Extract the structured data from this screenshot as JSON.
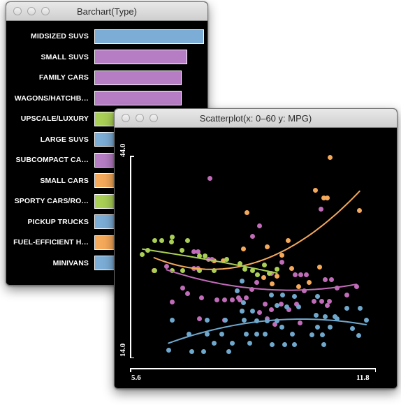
{
  "barchart_window": {
    "title": "Barchart(Type)",
    "traffic_lights": [
      "close",
      "minimize",
      "zoom"
    ],
    "bars": [
      {
        "label": "MIDSIZED SUVS",
        "value": 157,
        "color": "#7cadd6"
      },
      {
        "label": "SMALL SUVS",
        "value": 133,
        "color": "#b67dc4"
      },
      {
        "label": "FAMILY CARS",
        "value": 125,
        "color": "#b67dc4"
      },
      {
        "label": "WAGONS/HATCHB…",
        "value": 125,
        "color": "#b67dc4"
      },
      {
        "label": "UPSCALE/LUXURY",
        "value": 52,
        "color": "#a9cf56"
      },
      {
        "label": "LARGE SUVS",
        "value": 52,
        "color": "#7cadd6"
      },
      {
        "label": "SUBCOMPACT CA…",
        "value": 52,
        "color": "#b67dc4"
      },
      {
        "label": "SMALL CARS",
        "value": 52,
        "color": "#f5a95a"
      },
      {
        "label": "SPORTY CARS/RO…",
        "value": 52,
        "color": "#a9cf56"
      },
      {
        "label": "PICKUP TRUCKS",
        "value": 52,
        "color": "#7cadd6"
      },
      {
        "label": "FUEL-EFFICIENT H…",
        "value": 36,
        "color": "#f5a95a"
      },
      {
        "label": "MINIVANS",
        "value": 36,
        "color": "#7cadd6"
      }
    ]
  },
  "scatter_window": {
    "title": "Scatterplot(x: 0–60 y: MPG)",
    "traffic_lights": [
      "close",
      "minimize",
      "zoom"
    ]
  },
  "chart_data": {
    "type": "scatter",
    "title": "Scatterplot(x: 0–60 y: MPG)",
    "xlabel": "0-60",
    "ylabel": "MPG",
    "xlim": [
      5.6,
      11.8
    ],
    "ylim": [
      14.0,
      44.0
    ],
    "xticks": [
      "5.6",
      "11.8"
    ],
    "yticks": [
      "14.0",
      "44.0"
    ],
    "grid": false,
    "legend": "none",
    "background": "#000000",
    "series": [
      {
        "name": "orange",
        "color": "#f5a95a",
        "points": [
          [
            10.62,
            43.7
          ],
          [
            10.24,
            38.9
          ],
          [
            10.46,
            37.7
          ],
          [
            10.54,
            37.7
          ],
          [
            11.38,
            35.9
          ],
          [
            8.48,
            35.6
          ],
          [
            9.54,
            31.4
          ],
          [
            8.38,
            30.2
          ],
          [
            9.0,
            30.5
          ],
          [
            9.38,
            29.3
          ],
          [
            7.62,
            28.4
          ],
          [
            7.86,
            28.4
          ],
          [
            9.62,
            27.3
          ],
          [
            9.25,
            26.2
          ],
          [
            10.35,
            27.5
          ],
          [
            9.12,
            25.0
          ],
          [
            8.9,
            25.9
          ],
          [
            10.08,
            25.2
          ],
          [
            9.8,
            24.6
          ],
          [
            6.08,
            27.0
          ]
        ],
        "trend": "quadratic-increasing"
      },
      {
        "name": "magenta",
        "color": "#c06cb8",
        "points": [
          [
            7.52,
            40.6
          ],
          [
            10.38,
            36.1
          ],
          [
            8.8,
            33.6
          ],
          [
            8.62,
            32.1
          ],
          [
            7.1,
            29.8
          ],
          [
            7.22,
            29.8
          ],
          [
            7.48,
            28.6
          ],
          [
            7.58,
            28.6
          ],
          [
            6.4,
            27.6
          ],
          [
            7.1,
            27.3
          ],
          [
            7.22,
            27.3
          ],
          [
            9.38,
            28.2
          ],
          [
            9.1,
            26.6
          ],
          [
            9.72,
            26.4
          ],
          [
            9.86,
            26.4
          ],
          [
            10.0,
            26.4
          ],
          [
            8.72,
            25.2
          ],
          [
            6.82,
            24.4
          ],
          [
            8.6,
            24.2
          ],
          [
            9.95,
            24.0
          ],
          [
            10.8,
            24.4
          ],
          [
            11.3,
            24.6
          ],
          [
            10.5,
            25.6
          ],
          [
            10.65,
            25.6
          ],
          [
            8.25,
            23.0
          ],
          [
            8.45,
            23.0
          ],
          [
            7.7,
            22.6
          ],
          [
            7.9,
            22.6
          ],
          [
            8.1,
            22.6
          ],
          [
            8.3,
            22.6
          ],
          [
            8.95,
            22.0
          ],
          [
            9.35,
            22.0
          ],
          [
            9.75,
            22.0
          ],
          [
            10.2,
            22.4
          ],
          [
            10.4,
            22.4
          ],
          [
            10.6,
            22.4
          ],
          [
            9.1,
            21.2
          ],
          [
            9.55,
            21.2
          ],
          [
            8.35,
            21.0
          ],
          [
            8.8,
            20.8
          ],
          [
            7.25,
            19.8
          ],
          [
            7.9,
            19.6
          ],
          [
            9.0,
            19.8
          ],
          [
            9.2,
            19.0
          ],
          [
            9.85,
            19.2
          ],
          [
            10.55,
            21.8
          ],
          [
            6.95,
            23.6
          ],
          [
            7.3,
            23.0
          ],
          [
            6.55,
            22.3
          ],
          [
            11.05,
            23.4
          ]
        ],
        "trend": "increasing-curve"
      },
      {
        "name": "green",
        "color": "#a9cf56",
        "points": [
          [
            6.55,
            32.0
          ],
          [
            6.1,
            31.4
          ],
          [
            6.28,
            31.4
          ],
          [
            6.52,
            31.2
          ],
          [
            6.95,
            31.4
          ],
          [
            5.78,
            29.4
          ],
          [
            6.8,
            30.0
          ],
          [
            7.25,
            29.2
          ],
          [
            7.4,
            29.2
          ],
          [
            7.95,
            28.6
          ],
          [
            8.3,
            28.0
          ],
          [
            6.1,
            27.0
          ],
          [
            6.55,
            27.0
          ],
          [
            6.82,
            27.0
          ],
          [
            7.25,
            27.0
          ],
          [
            7.62,
            27.0
          ],
          [
            8.62,
            27.0
          ],
          [
            8.42,
            27.2
          ],
          [
            8.92,
            27.8
          ],
          [
            9.05,
            26.6
          ],
          [
            9.25,
            27.2
          ],
          [
            8.75,
            26.4
          ],
          [
            5.92,
            30.0
          ]
        ],
        "trend": "hump-then-decline"
      },
      {
        "name": "blue",
        "color": "#6fa8cd",
        "points": [
          [
            8.35,
            25.4
          ],
          [
            8.22,
            24.0
          ],
          [
            9.1,
            23.4
          ],
          [
            9.4,
            23.4
          ],
          [
            9.7,
            23.2
          ],
          [
            10.3,
            23.2
          ],
          [
            8.38,
            22.2
          ],
          [
            9.25,
            21.8
          ],
          [
            9.5,
            21.6
          ],
          [
            9.8,
            21.6
          ],
          [
            11.05,
            21.4
          ],
          [
            11.4,
            21.4
          ],
          [
            8.35,
            21.0
          ],
          [
            8.62,
            21.0
          ],
          [
            10.25,
            20.4
          ],
          [
            10.5,
            20.2
          ],
          [
            10.75,
            20.2
          ],
          [
            6.55,
            19.6
          ],
          [
            7.45,
            19.6
          ],
          [
            7.92,
            19.6
          ],
          [
            8.4,
            19.6
          ],
          [
            8.72,
            19.5
          ],
          [
            9.0,
            19.5
          ],
          [
            9.25,
            19.5
          ],
          [
            10.8,
            19.8
          ],
          [
            11.55,
            19.6
          ],
          [
            9.38,
            18.6
          ],
          [
            10.3,
            18.6
          ],
          [
            10.62,
            18.6
          ],
          [
            11.2,
            18.4
          ],
          [
            6.98,
            17.6
          ],
          [
            7.45,
            17.6
          ],
          [
            7.82,
            17.6
          ],
          [
            8.45,
            17.6
          ],
          [
            8.72,
            17.6
          ],
          [
            8.95,
            17.6
          ],
          [
            9.65,
            17.6
          ],
          [
            10.15,
            17.5
          ],
          [
            10.42,
            17.5
          ],
          [
            11.35,
            17.4
          ],
          [
            7.62,
            16.2
          ],
          [
            8.1,
            16.2
          ],
          [
            8.55,
            16.2
          ],
          [
            9.12,
            16.0
          ],
          [
            9.45,
            16.0
          ],
          [
            9.7,
            16.0
          ],
          [
            10.45,
            16.0
          ],
          [
            6.45,
            15.2
          ],
          [
            7.05,
            15.0
          ],
          [
            7.35,
            15.0
          ],
          [
            8.0,
            15.0
          ]
        ],
        "trend": "flat-slightly-increasing"
      }
    ]
  }
}
